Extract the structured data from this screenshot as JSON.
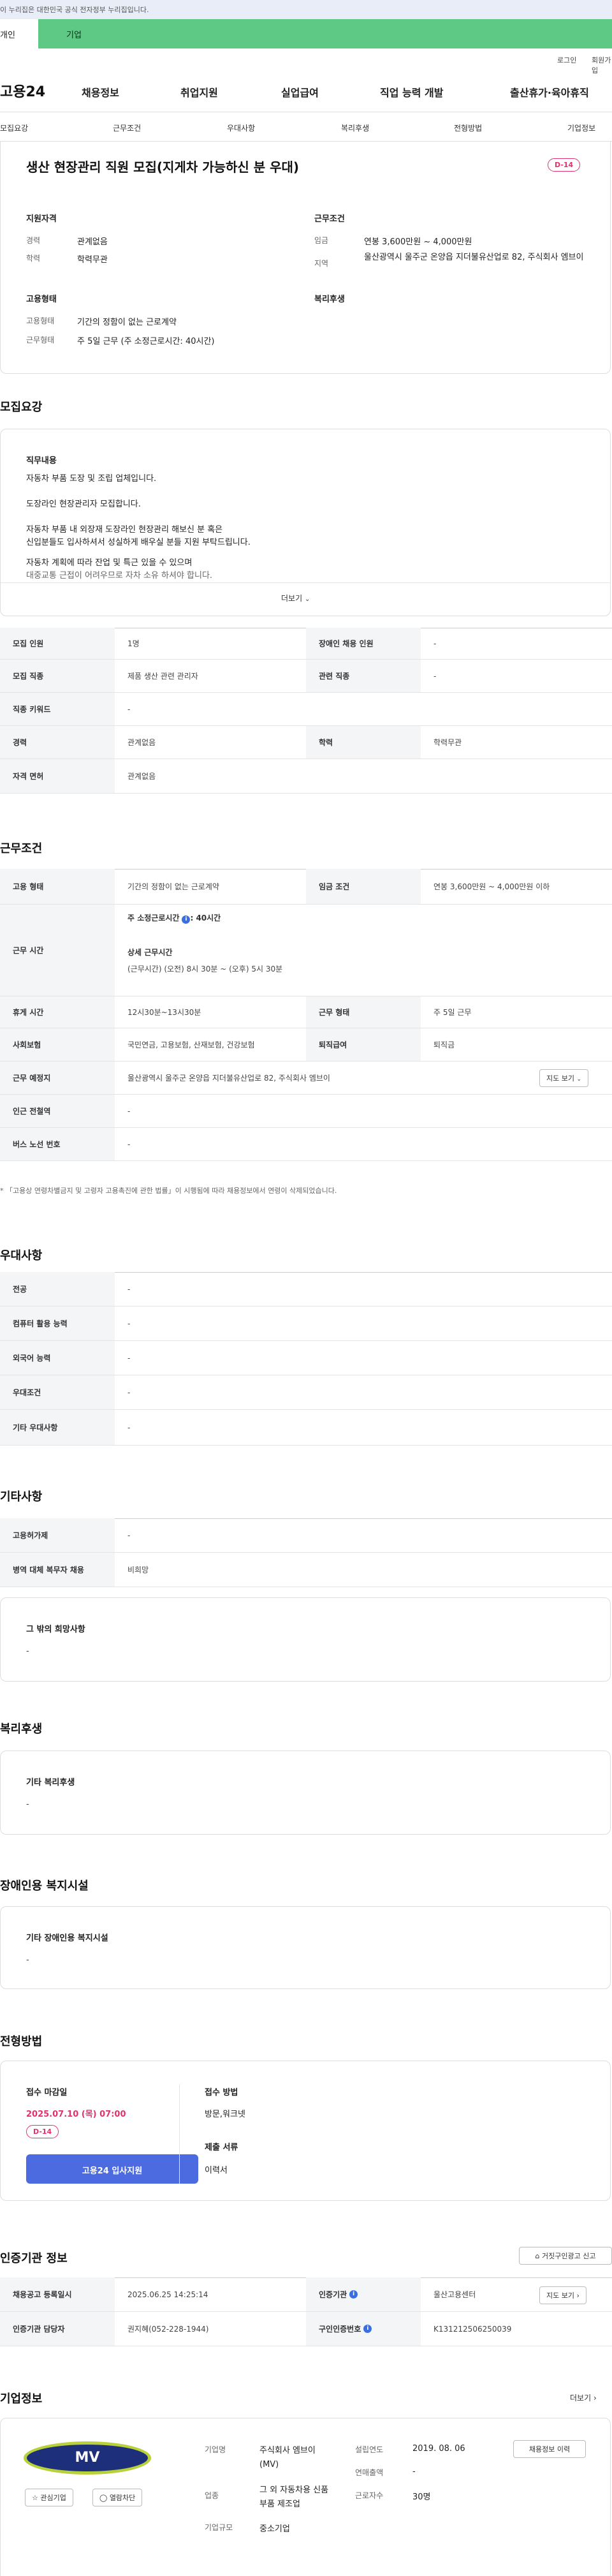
{
  "gov_banner": "이 누리집은 대한민국 공식 전자정부 누리집입니다.",
  "top_tabs": {
    "personal": "개인",
    "company": "기업"
  },
  "util": {
    "login": "로그인",
    "join": "회원가입"
  },
  "header": {
    "logo": "고용24",
    "menu": [
      "채용정보",
      "취업지원",
      "실업급여",
      "직업 능력 개발",
      "출산휴가·육아휴직"
    ]
  },
  "subnav": [
    "모집요강",
    "근무조건",
    "우대사항",
    "복리후생",
    "전형방법",
    "기업정보"
  ],
  "job": {
    "title": "생산 현장관리 직원 모집(지게차 가능하신 분 우대)",
    "dday": "D-14",
    "qual_title": "지원자격",
    "qual": [
      {
        "label": "경력",
        "value": "관계없음"
      },
      {
        "label": "학력",
        "value": "학력무관"
      }
    ],
    "cond_title": "근무조건",
    "cond": [
      {
        "label": "임금",
        "value": "연봉 3,600만원 ~ 4,000만원"
      },
      {
        "label": "지역",
        "value": "울산광역시 울주군 온양읍 지더불유산업로 82, 주식회사 엠브이"
      }
    ],
    "emp_title": "고용형태",
    "emp": [
      {
        "label": "고용형태",
        "value": "기간의 정함이 없는 근로계약"
      },
      {
        "label": "근무형태",
        "value": "주 5일 근무 (주 소정근로시간: 40시간)"
      }
    ],
    "welfare_title": "복리후생"
  },
  "recruit": {
    "heading": "모집요강",
    "duty_title": "직무내용",
    "duty_lines": [
      "자동차 부품 도장 및 조립 업체입니다.",
      "도장라인 현장관리자 모집합니다.",
      "자동차 부품 내 외장재 도장라인 현장관리 해보신 분 혹은",
      "신입분들도 입사하셔서 성실하게 배우실 분들 지원 부탁드립니다.",
      "자동차 계획에 따라 잔업 및 특근 있을 수 있으며",
      "대중교통 근접이 어려우므로 자차 소유 하셔야 합니다."
    ],
    "more": "더보기",
    "table": [
      {
        "h1": "모집 인원",
        "v1": "1명",
        "h2": "장애인 채용 인원",
        "v2": "-"
      },
      {
        "h1": "모집 직종",
        "v1": "제품 생산 관련 관리자",
        "h2": "관련 직종",
        "v2": "-"
      },
      {
        "h1": "직종 키워드",
        "v1": "-"
      },
      {
        "h1": "경력",
        "v1": "관계없음",
        "h2": "학력",
        "v2": "학력무관"
      },
      {
        "h1": "자격 면허",
        "v1": "관계없음"
      }
    ]
  },
  "conditions": {
    "heading": "근무조건",
    "emp_type_h": "고용 형태",
    "emp_type_v": "기간의 정함이 없는 근로계약",
    "wage_h": "임금 조건",
    "wage_v": "연봉 3,600만원 ~ 4,000만원 이하",
    "hours_h": "근무 시간",
    "hours_main_label": "주 소정근로시간",
    "hours_main_value": ": 40시간",
    "hours_detail_title": "상세 근무시간",
    "hours_detail": "(근무시간) (오전) 8시 30분 ~ (오후) 5시 30분",
    "break_h": "휴게 시간",
    "break_v": "12시30분~13시30분",
    "worktype_h": "근무 형태",
    "worktype_v": "주 5일 근무",
    "insure_h": "사회보험",
    "insure_v": "국민연금, 고용보험, 산재보험, 건강보험",
    "retire_h": "퇴직급여",
    "retire_v": "퇴직금",
    "place_h": "근무 예정지",
    "place_v": "울산광역시 울주군 온양읍 지더불유산업로 82, 주식회사 엠브이",
    "map_btn": "지도 보기",
    "subway_h": "인근 전철역",
    "subway_v": "-",
    "bus_h": "버스 노선 번호",
    "bus_v": "-",
    "note": "* 「고용상 연령차별금지 및 고령자 고용촉진에 관한 법률」이 시행됨에 따라 채용정보에서 연령이 삭제되었습니다."
  },
  "preferred": {
    "heading": "우대사항",
    "rows": [
      {
        "h": "전공",
        "v": "-"
      },
      {
        "h": "컴퓨터 활용 능력",
        "v": "-"
      },
      {
        "h": "외국어 능력",
        "v": "-"
      },
      {
        "h": "우대조건",
        "v": "-"
      },
      {
        "h": "기타 우대사항",
        "v": "-"
      }
    ]
  },
  "etc": {
    "heading": "기타사항",
    "rows": [
      {
        "h": "고용허가제",
        "v": "-"
      },
      {
        "h": "병역 대체 복무자 채용",
        "v": "비희망"
      }
    ],
    "hope_title": "그 밖의 희망사항",
    "hope_value": "-"
  },
  "welfare": {
    "heading": "복리후생",
    "title": "기타 복리후생",
    "value": "-"
  },
  "disability": {
    "heading": "장애인용 복지시설",
    "title": "기타 장애인용 복지시설",
    "value": "-"
  },
  "selection": {
    "heading": "전형방법",
    "deadline_title": "접수 마감일",
    "deadline": "2025.07.10 (목) 07:00",
    "dday": "D-14",
    "apply_btn": "고용24 입사지원",
    "method_title": "접수 방법",
    "method": "방문,워크넷",
    "docs_title": "제출 서류",
    "docs": "이력서"
  },
  "agency": {
    "heading": "인증기관 정보",
    "report_btn": "거짓구인광고 신고",
    "reg_h": "채용공고 등록일시",
    "reg_v": "2025.06.25 14:25:14",
    "agency_h": "인증기관",
    "agency_v": "울산고용센터",
    "map_btn": "지도 보기",
    "manager_h": "인증기관 담당자",
    "manager_v": "권지혜(052-228-1944)",
    "jobno_h": "구인인증번호",
    "jobno_v": "K131212506250039"
  },
  "company": {
    "heading": "기업정보",
    "more": "더보기",
    "logo_text": "MV",
    "interest_btn": "관심기업",
    "block_btn": "열람차단",
    "name_h": "기업명",
    "name_v": "주식회사 엠브이 (MV)",
    "founded_h": "설립연도",
    "founded_v": "2019. 08. 06",
    "sales_h": "연매출액",
    "sales_v": "-",
    "industry_h": "업종",
    "industry_v": "그 외 자동차용 신품 부품 제조업",
    "employees_h": "근로자수",
    "employees_v": "30명",
    "size_h": "기업규모",
    "size_v": "중소기업",
    "jobs_btn": "채용정보 이력"
  },
  "colors": {
    "accent_green": "#5ec885",
    "dday_pink": "#e0336c",
    "apply_blue": "#4d6be0"
  }
}
